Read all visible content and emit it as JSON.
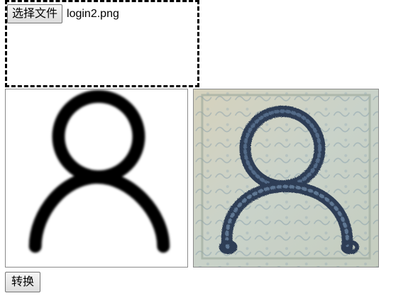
{
  "file_input": {
    "button_label": "选择文件",
    "file_name": "login2.png"
  },
  "source_image": {
    "icon": "user-profile-icon"
  },
  "result_image": {
    "icon": "user-profile-stylized-icon"
  },
  "actions": {
    "convert_label": "转换"
  }
}
